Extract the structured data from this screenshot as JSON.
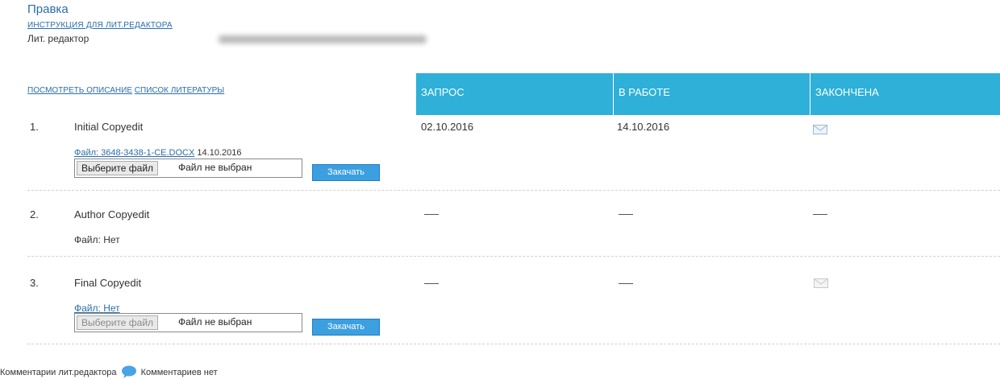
{
  "section": {
    "title": "Правка",
    "instructions_link": "ИНСТРУКЦИЯ ДЛЯ ЛИТ.РЕДАКТОРА",
    "editor_label": "Лит. редактор"
  },
  "links": {
    "view_description": "ПОСМОТРЕТЬ ОПИСАНИЕ",
    "references": "СПИСОК ЛИТЕРАТУРЫ"
  },
  "table": {
    "columns": [
      "ЗАПРОС",
      "В РАБОТЕ",
      "ЗАКОНЧЕНА"
    ],
    "rows": [
      {
        "number": "1.",
        "title": "Initial Copyedit",
        "file_label": "Файл:",
        "file_name": "3648-3438-1-CE.DOCX",
        "file_date": "14.10.2016",
        "request": "02.10.2016",
        "in_progress": "14.10.2016",
        "completed_icon": "envelope-icon",
        "choose_file": "Выберите файл",
        "no_file": "Файл не выбран",
        "upload": "Закачать"
      },
      {
        "number": "2.",
        "title": "Author Copyedit",
        "file_label": "Файл:",
        "file_name": "Нет",
        "request": "—",
        "in_progress": "—",
        "completed": "—"
      },
      {
        "number": "3.",
        "title": "Final Copyedit",
        "file_label": "Файл:",
        "file_name": "Нет",
        "request": "—",
        "in_progress": "—",
        "completed_icon": "envelope-icon",
        "choose_file": "Выберите файл",
        "no_file": "Файл не выбран",
        "upload": "Закачать"
      }
    ]
  },
  "comments": {
    "label": "Комментарии лит.редактора",
    "icon": "comment-bubble-icon",
    "value": "Комментариев нет"
  },
  "colors": {
    "header_bg": "#2eb0d8",
    "link": "#2a6ea8",
    "button": "#3c9fe0"
  }
}
